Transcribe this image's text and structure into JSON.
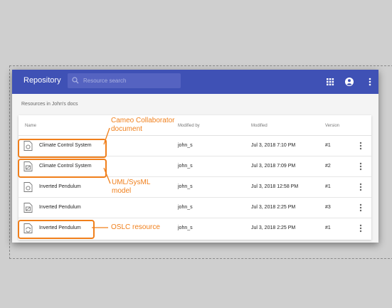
{
  "app": {
    "title": "Repository"
  },
  "search": {
    "placeholder": "Resource search"
  },
  "toolbar": {
    "icons": [
      "apps-grid-icon",
      "account-icon",
      "more-vert-icon"
    ]
  },
  "breadcrumb": "Resources in John's docs",
  "table": {
    "columns": [
      "Name",
      "Modified by",
      "Modified",
      "Version"
    ],
    "rows": [
      {
        "name": "Climate Control System",
        "modified_by": "john_s",
        "modified": "Jul 3, 2018 7:10 PM",
        "version": "#1",
        "icon": "collaborator-document-icon"
      },
      {
        "name": "Climate Control System",
        "modified_by": "john_s",
        "modified": "Jul 3, 2018 7:09 PM",
        "version": "#2",
        "icon": "uml-model-icon"
      },
      {
        "name": "Inverted Pendulum",
        "modified_by": "john_s",
        "modified": "Jul 3, 2018 12:58 PM",
        "version": "#1",
        "icon": "collaborator-document-icon"
      },
      {
        "name": "Inverted Pendulum",
        "modified_by": "john_s",
        "modified": "Jul 3, 2018 2:25 PM",
        "version": "#3",
        "icon": "uml-model-icon"
      },
      {
        "name": "Inverted Pendulum",
        "modified_by": "john_s",
        "modified": "Jul 3, 2018 2:25 PM",
        "version": "#1",
        "icon": "oslc-resource-icon"
      }
    ]
  },
  "annotations": {
    "collaborator_line1": "Cameo Collaborator",
    "collaborator_line2": "document",
    "uml_line1": "UML/SysML",
    "uml_line2": "model",
    "oslc": "OSLC resource",
    "color": "#f07f1b"
  },
  "colors": {
    "appbar": "#3f51b5",
    "background": "#cfcfcf"
  }
}
